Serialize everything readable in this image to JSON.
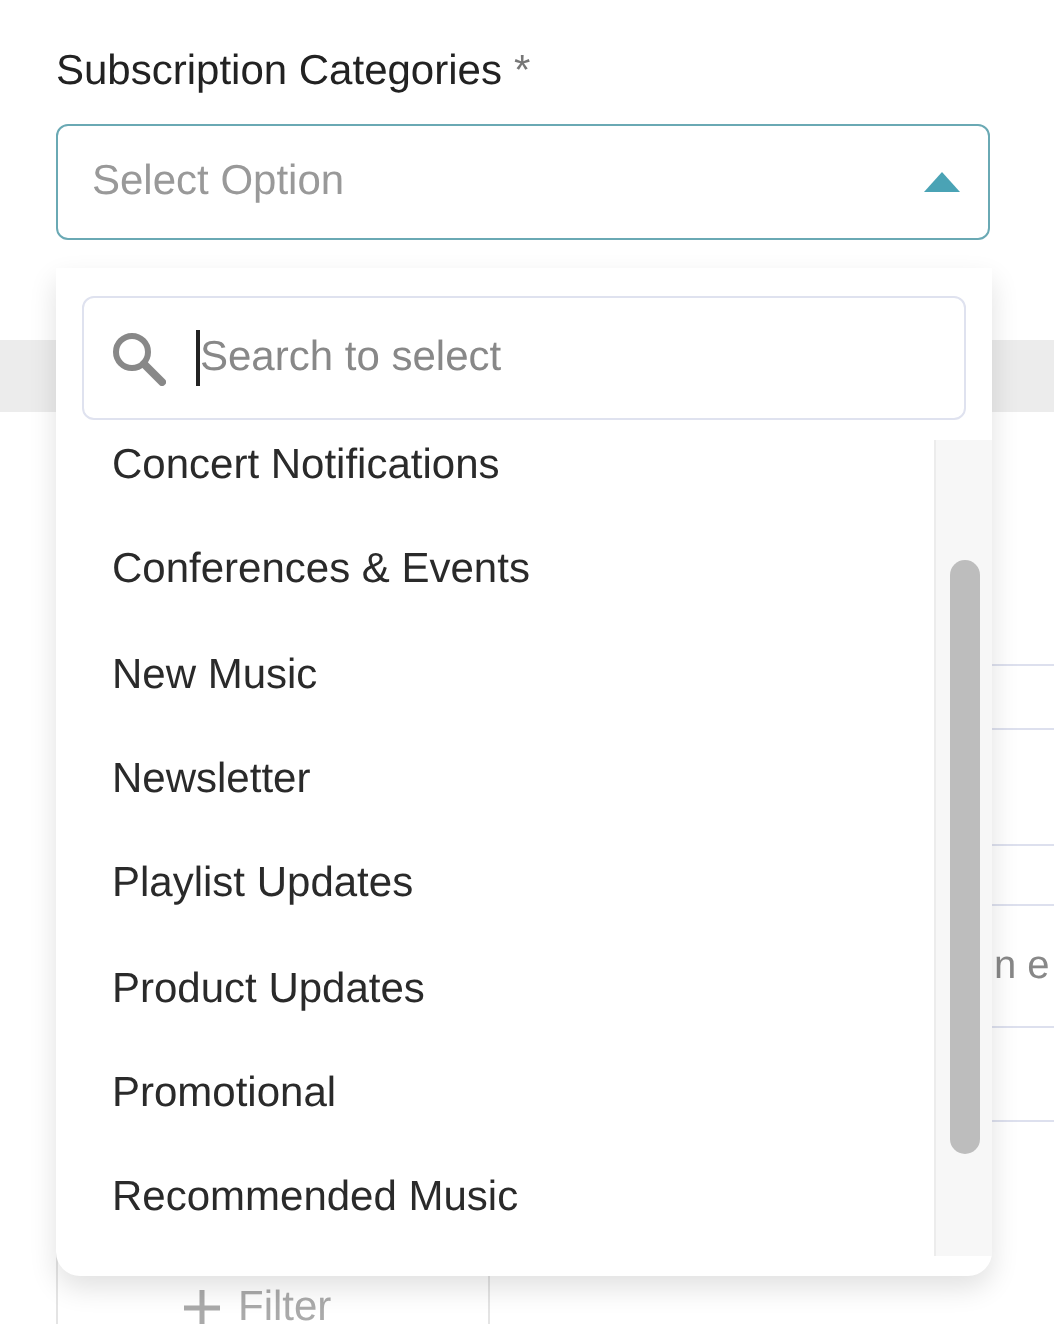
{
  "field": {
    "label": "Subscription Categories",
    "required_mark": "*",
    "placeholder": "Select Option",
    "expanded": true
  },
  "dropdown": {
    "search_placeholder": "Search to select",
    "options": [
      "Concert Notifications",
      "Conferences & Events",
      "New Music",
      "Newsletter",
      "Playlist Updates",
      "Product Updates",
      "Promotional",
      "Recommended Music"
    ]
  },
  "background": {
    "row_text": "n e",
    "filter_button": "Filter"
  }
}
